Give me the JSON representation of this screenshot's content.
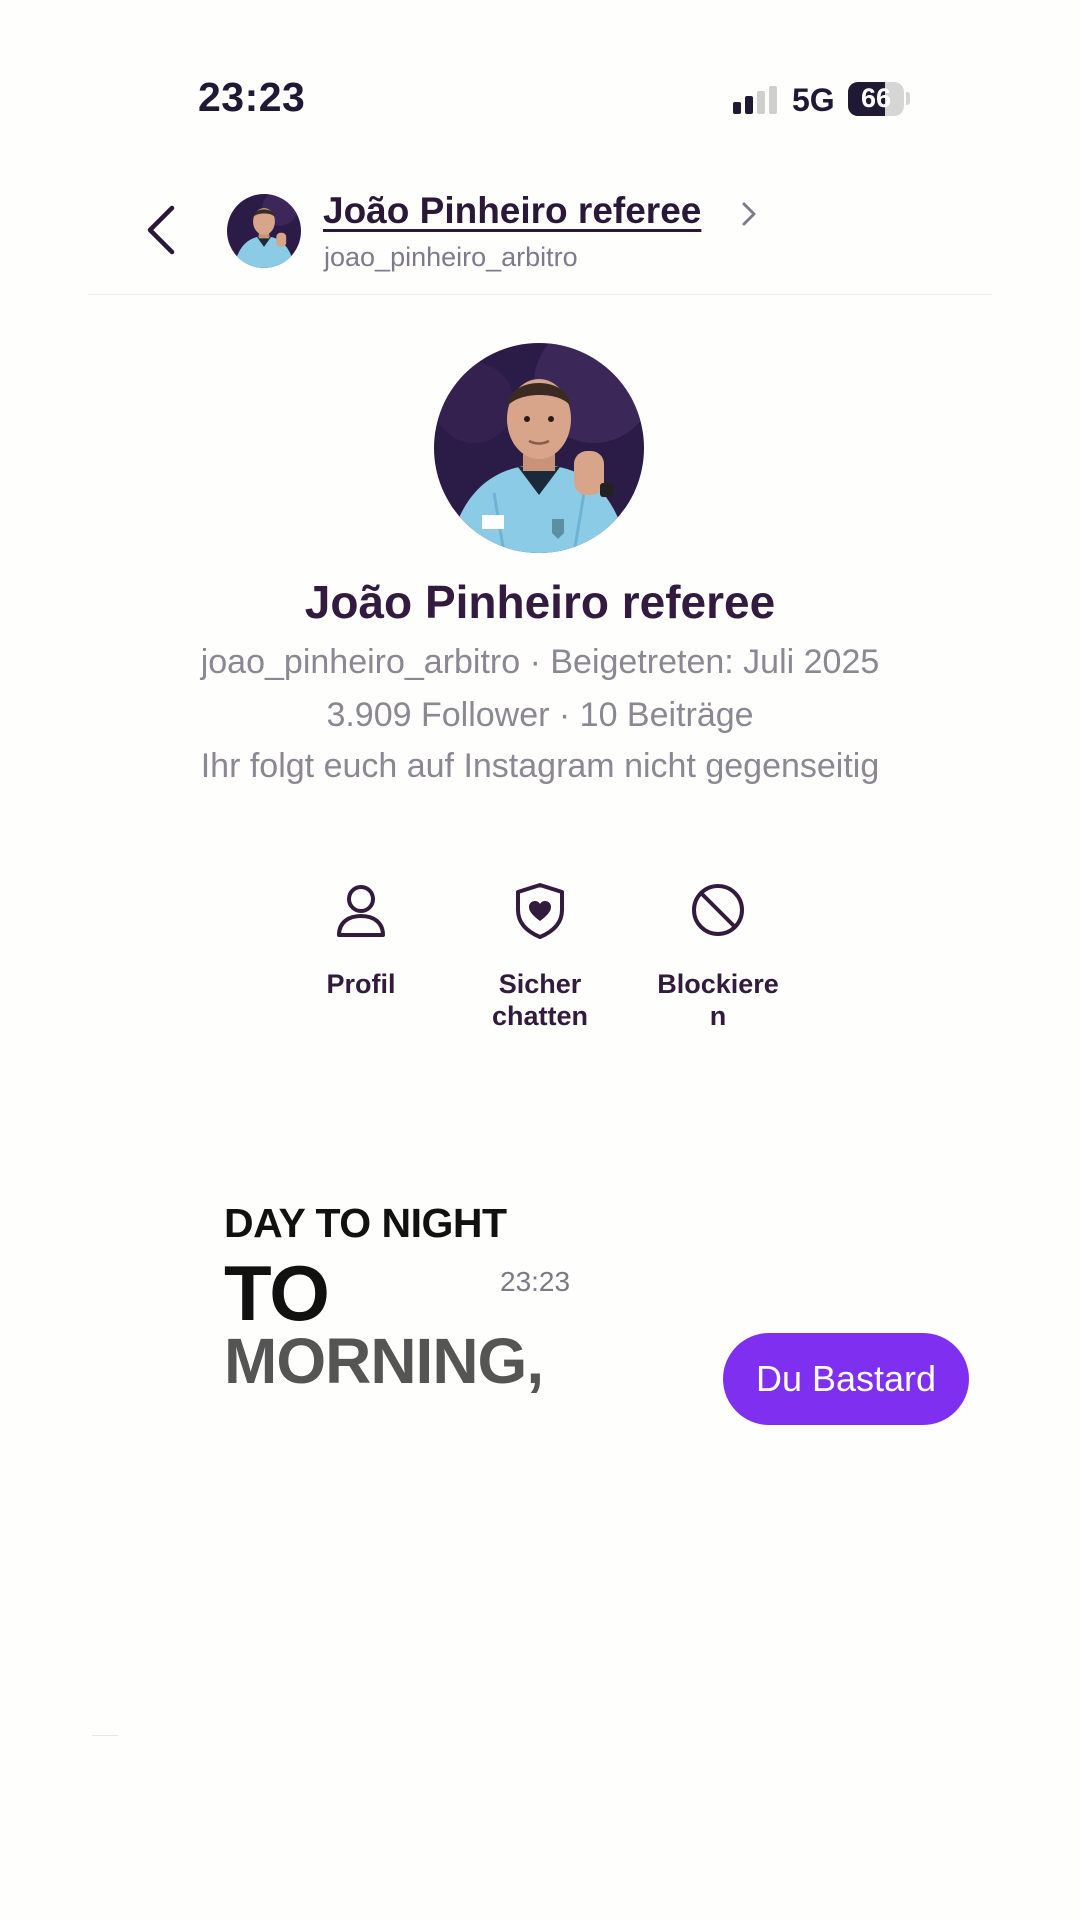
{
  "status_bar": {
    "time": "23:23",
    "network": "5G",
    "battery": "66",
    "battery_level": 0.66,
    "signal_bars_active": 2,
    "signal_bars_total": 4
  },
  "header": {
    "name": "João Pinheiro referee",
    "username": "joao_pinheiro_arbitro"
  },
  "profile": {
    "name": "João Pinheiro referee",
    "meta_line": "joao_pinheiro_arbitro · Beigetreten: Juli 2025",
    "stats_line": "3.909 Follower · 10 Beiträge",
    "relation_line": "Ihr folgt euch auf Instagram nicht gegenseitig"
  },
  "actions": [
    {
      "label": "Profil",
      "icon": "person-icon"
    },
    {
      "label": "Sicher\nchatten",
      "icon": "shield-heart-icon"
    },
    {
      "label": "Blockiere\nn",
      "icon": "block-icon"
    }
  ],
  "conversation": {
    "sticker": {
      "line1": "DAY TO NIGHT",
      "line2": "TO",
      "line3": "MORNING,"
    },
    "timestamp": "23:23",
    "sent_message": "Du Bastard"
  },
  "colors": {
    "accent_purple": "#7f2ff0",
    "text_dark": "#2e1b3d",
    "text_muted": "#8b8793",
    "background": "#fefefc"
  }
}
